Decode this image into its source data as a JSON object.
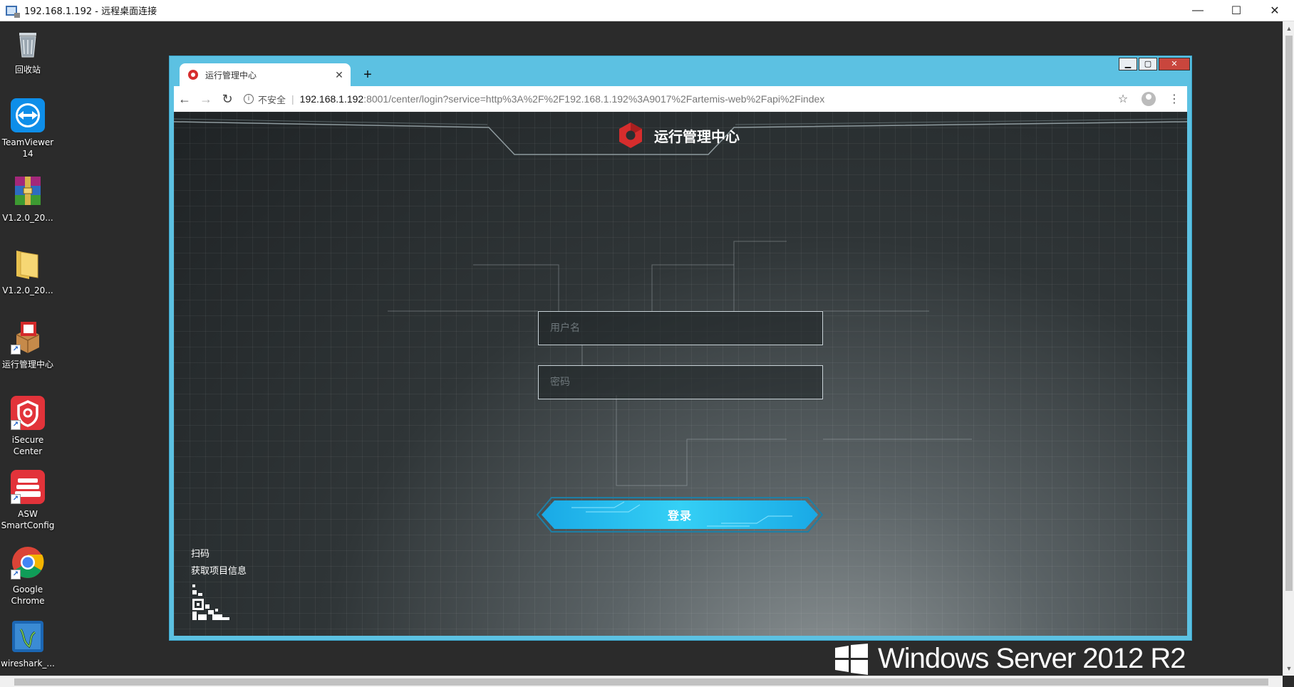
{
  "rdp": {
    "title": "192.168.1.192 - 远程桌面连接",
    "controls": {
      "minimize": "—",
      "maximize": "☐",
      "close": "✕"
    }
  },
  "desktop_icons": [
    {
      "name": "recycle-bin",
      "label": "回收站"
    },
    {
      "name": "teamviewer",
      "label": "TeamViewer 14"
    },
    {
      "name": "winrar",
      "label": "V1.2.0_20..."
    },
    {
      "name": "folder",
      "label": "V1.2.0_20..."
    },
    {
      "name": "yunxing",
      "label": "运行管理中心"
    },
    {
      "name": "isecure",
      "label": "iSecure Center"
    },
    {
      "name": "asw",
      "label": "ASW SmartConfig"
    },
    {
      "name": "chrome",
      "label": "Google Chrome"
    },
    {
      "name": "wireshark",
      "label": "wireshark_..."
    }
  ],
  "browser": {
    "tab_title": "运行管理中心",
    "tab_close": "✕",
    "new_tab": "+",
    "nav": {
      "back": "←",
      "forward": "→",
      "reload": "↻"
    },
    "security_label": "不安全",
    "url_host": "192.168.1.192",
    "url_rest": ":8001/center/login?service=http%3A%2F%2F192.168.1.192%3A9017%2Fartemis-web%2Fapi%2Findex",
    "star": "☆",
    "menu": "⋮",
    "window_controls": {
      "minimize": "▁",
      "maximize": "▢",
      "close": "✕"
    }
  },
  "login": {
    "title": "运行管理中心",
    "username_placeholder": "用户名",
    "password_placeholder": "密码",
    "login_label": "登录",
    "scan_link": "扫码",
    "project_info_link": "获取项目信息"
  },
  "branding": {
    "text": "Windows Server 2012 R2"
  },
  "colors": {
    "accent": "#1fb6ea",
    "browser_frame": "#5cc1e2",
    "logo_red": "#d62d2d"
  }
}
